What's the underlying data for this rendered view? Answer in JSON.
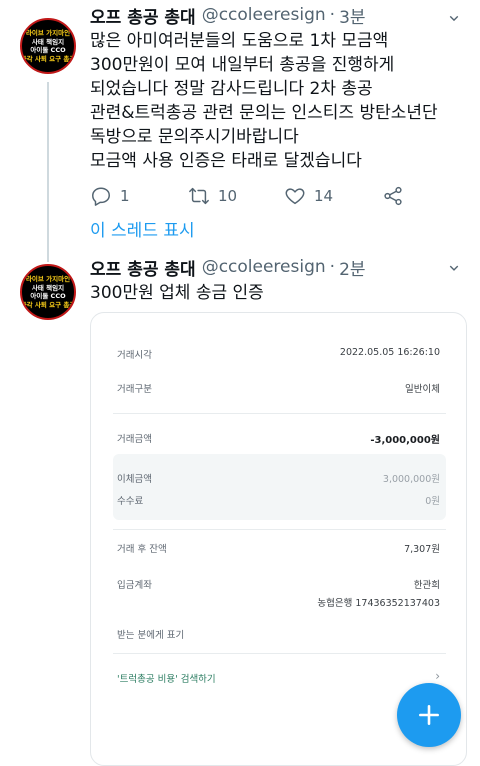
{
  "tweet1": {
    "avatar_lines": [
      "라이브 가지마인",
      "사태 책임지",
      "아이돌 CCO",
      "즉각 사퇴 요구 총공"
    ],
    "name": "오프 총공 총대",
    "handle": "@ccoleeresign",
    "time": "3분",
    "text_lines": [
      "많은 아미여러분들의 도움으로 1차 모금액",
      "300만원이 모여 내일부터 총공을 진행하게",
      "되었습니다 정말 감사드립니다 2차 총공",
      "관련&트럭총공 관련 문의는 인스티즈 방탄소년단",
      "독방으로 문의주시기바랍니다",
      "모금액 사용 인증은 타래로 달겠습니다"
    ],
    "reply_count": "1",
    "retweet_count": "10",
    "like_count": "14",
    "show_thread": "이 스레드 표시"
  },
  "tweet2": {
    "avatar_lines": [
      "라이브 가지마인",
      "사태 책임지",
      "아이돌 CCO",
      "즉각 사퇴 요구 총공"
    ],
    "name": "오프 총공 총대",
    "handle": "@ccoleeresign",
    "time": "2분",
    "text": "300만원 업체 송금 인증"
  },
  "receipt": {
    "rows": [
      {
        "label": "거래시각",
        "value": "2022.05.05 16:26:10"
      },
      {
        "label": "거래구분",
        "value": "일반이체"
      },
      {
        "label": "거래금액",
        "value": "-3,000,000원"
      },
      {
        "label": "이체금액",
        "value": "3,000,000원"
      },
      {
        "label": "수수료",
        "value": "0원"
      },
      {
        "label": "거래 후 잔액",
        "value": "7,307원"
      },
      {
        "label": "입금계좌",
        "value": "한관희"
      },
      {
        "label": "",
        "value": "농협은행 17436352137403"
      },
      {
        "label": "받는 분에게 표기",
        "value": ""
      }
    ],
    "search_link": "'트럭총공 비용' 검색하기"
  },
  "colors": {
    "accent": "#1d9bf0",
    "text": "#0f1419",
    "muted": "#536471"
  }
}
